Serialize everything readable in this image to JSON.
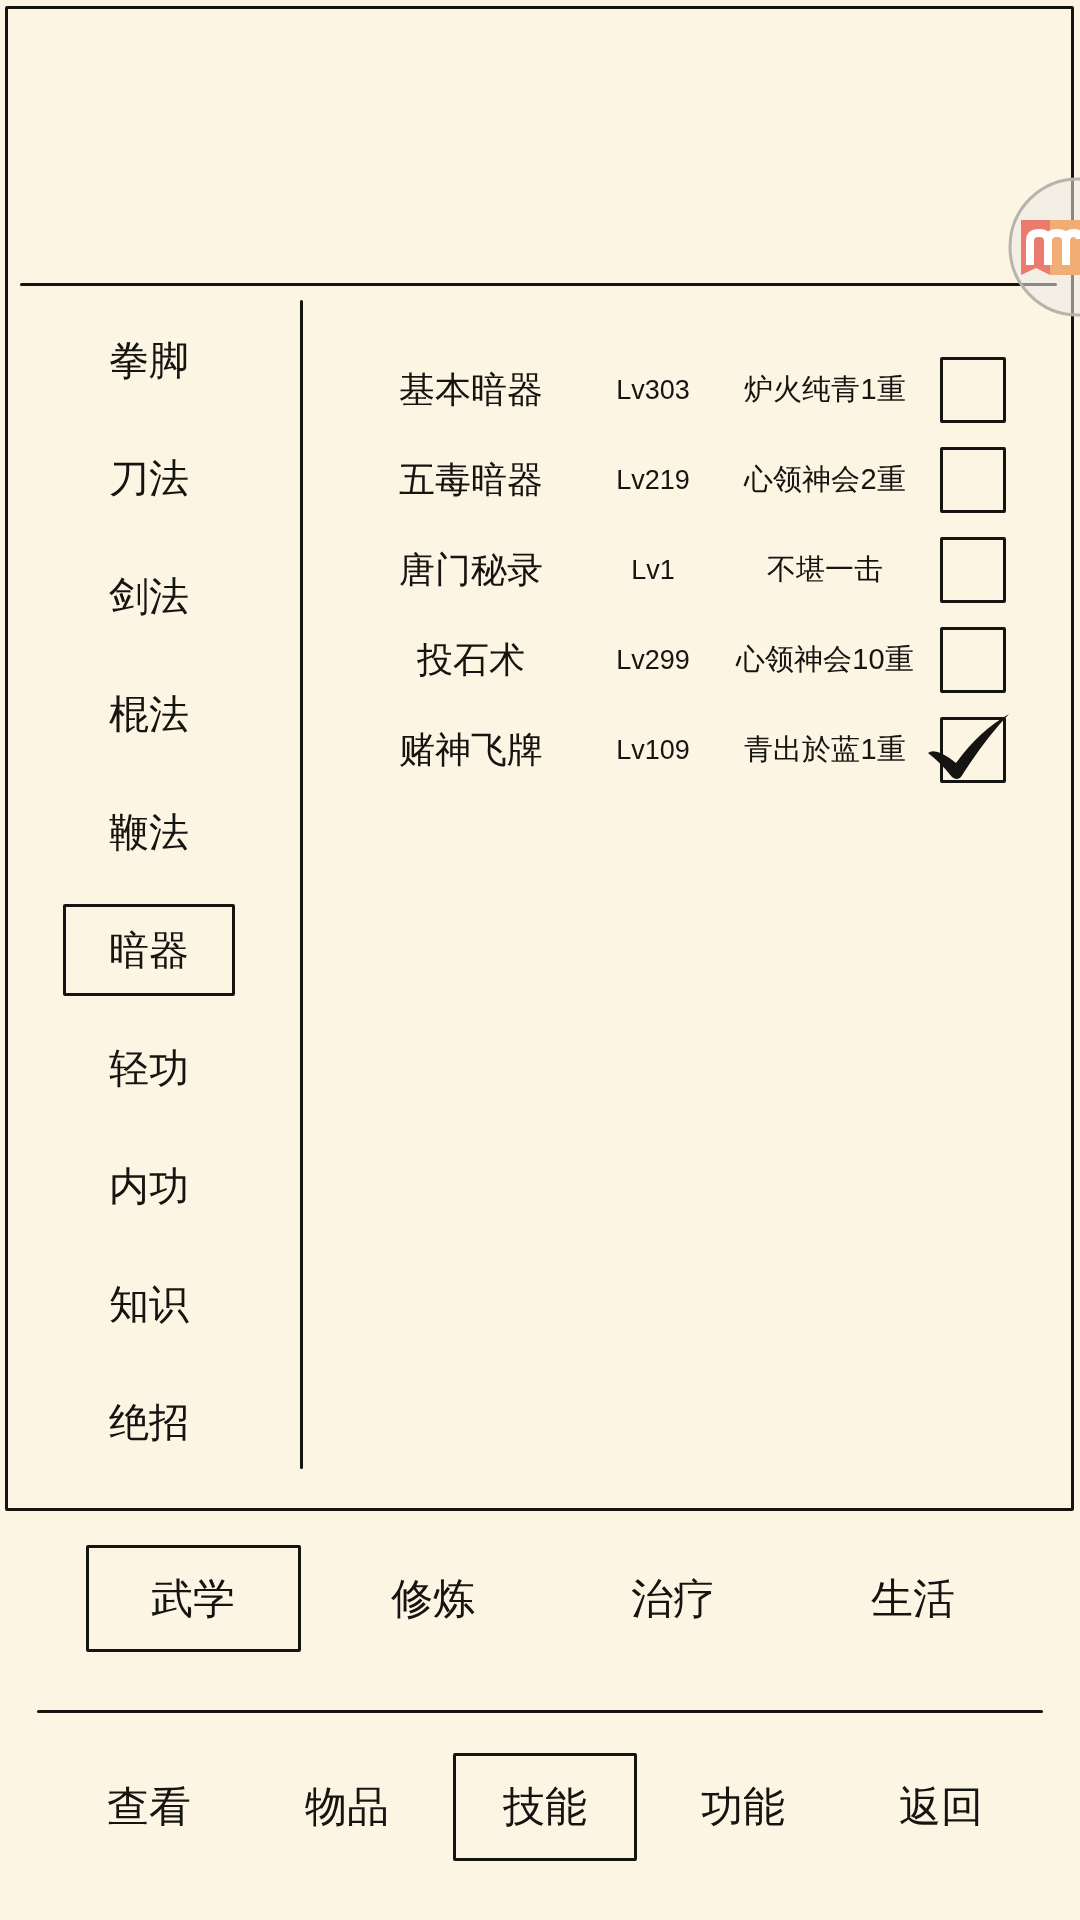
{
  "sidebar": {
    "items": [
      {
        "label": "拳脚",
        "selected": false
      },
      {
        "label": "刀法",
        "selected": false
      },
      {
        "label": "剑法",
        "selected": false
      },
      {
        "label": "棍法",
        "selected": false
      },
      {
        "label": "鞭法",
        "selected": false
      },
      {
        "label": "暗器",
        "selected": true
      },
      {
        "label": "轻功",
        "selected": false
      },
      {
        "label": "内功",
        "selected": false
      },
      {
        "label": "知识",
        "selected": false
      },
      {
        "label": "绝招",
        "selected": false
      }
    ]
  },
  "skills": [
    {
      "name": "基本暗器",
      "lv": "Lv303",
      "realm": "炉火纯青1重",
      "checked": false
    },
    {
      "name": "五毒暗器",
      "lv": "Lv219",
      "realm": "心领神会2重",
      "checked": false
    },
    {
      "name": "唐门秘录",
      "lv": "Lv1",
      "realm": "不堪一击",
      "checked": false
    },
    {
      "name": "投石术",
      "lv": "Lv299",
      "realm": "心领神会10重",
      "checked": false
    },
    {
      "name": "赌神飞牌",
      "lv": "Lv109",
      "realm": "青出於蓝1重",
      "checked": true
    }
  ],
  "categories": [
    {
      "label": "武学",
      "selected": true
    },
    {
      "label": "修炼",
      "selected": false
    },
    {
      "label": "治疗",
      "selected": false
    },
    {
      "label": "生活",
      "selected": false
    }
  ],
  "nav": [
    {
      "label": "查看",
      "selected": false
    },
    {
      "label": "物品",
      "selected": false
    },
    {
      "label": "技能",
      "selected": true
    },
    {
      "label": "功能",
      "selected": false
    },
    {
      "label": "返回",
      "selected": false
    }
  ]
}
